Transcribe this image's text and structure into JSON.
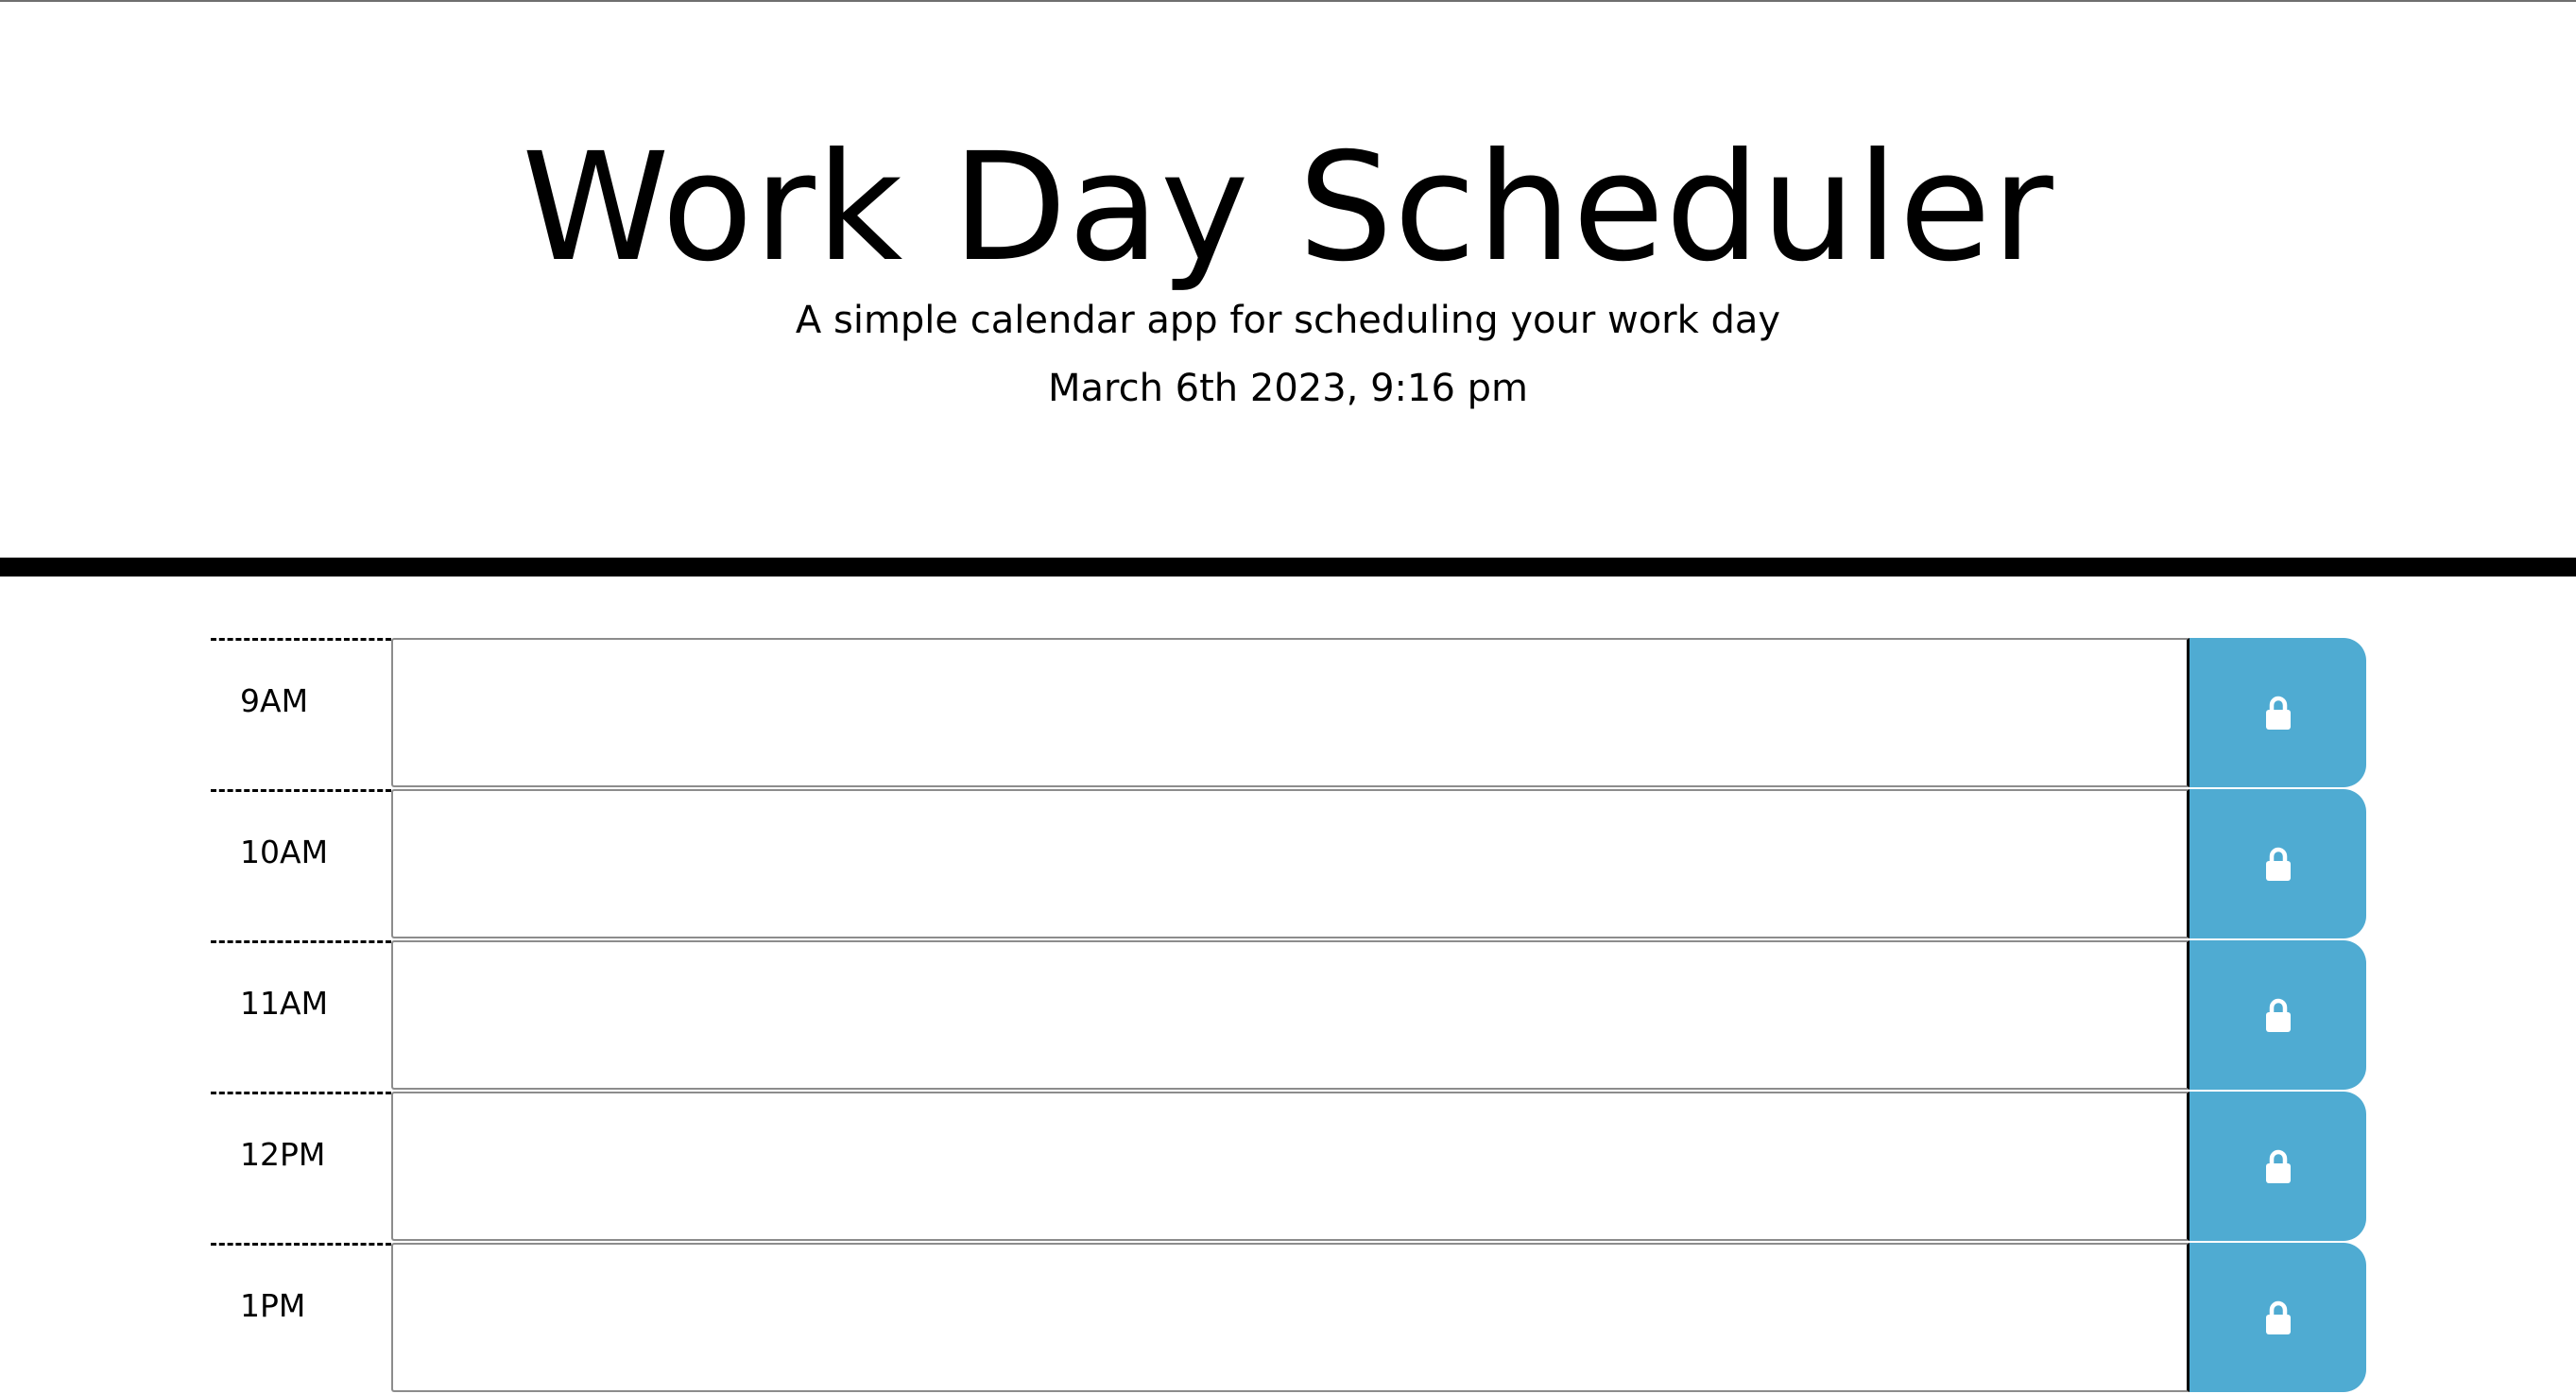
{
  "header": {
    "title": "Work Day Scheduler",
    "subtitle": "A simple calendar app for scheduling your work day",
    "current_day": "March 6th 2023, 9:16 pm"
  },
  "icons": {
    "save": "lock-icon"
  },
  "colors": {
    "save_button": "#4fabd2",
    "header_border": "#000000"
  },
  "schedule": {
    "blocks": [
      {
        "hour": "9AM",
        "description": ""
      },
      {
        "hour": "10AM",
        "description": ""
      },
      {
        "hour": "11AM",
        "description": ""
      },
      {
        "hour": "12PM",
        "description": ""
      },
      {
        "hour": "1PM",
        "description": ""
      }
    ]
  }
}
